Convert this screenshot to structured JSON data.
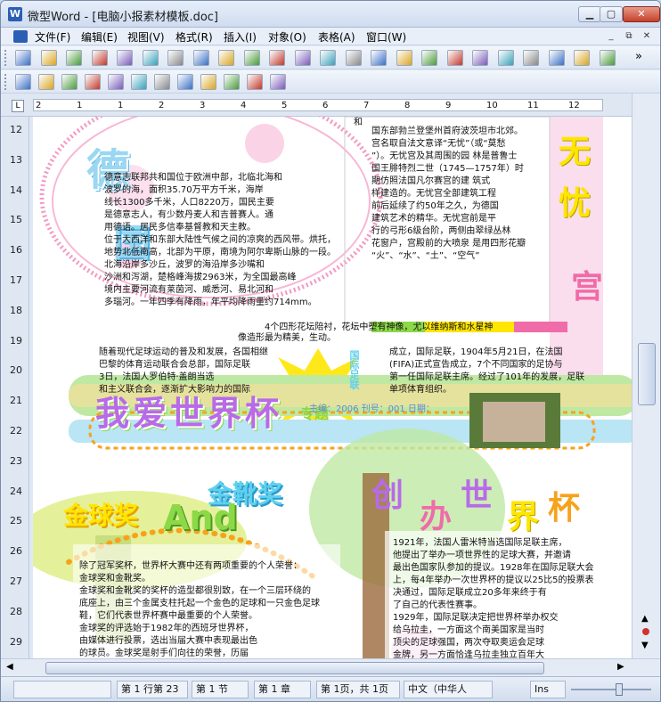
{
  "window": {
    "title": "微型Word - [电脑小报素材模板.doc]",
    "app_icon": "W",
    "controls": {
      "minimize": "▁",
      "maximize": "▢",
      "close": "✕"
    }
  },
  "menu": {
    "items": [
      "文件(F)",
      "编辑(E)",
      "视图(V)",
      "格式(R)",
      "插入(I)",
      "对象(O)",
      "表格(A)",
      "窗口(W)"
    ],
    "mdi": [
      "_",
      "⧉",
      "✕"
    ]
  },
  "toolbar1": {
    "icons": [
      "new-document-icon",
      "open-folder-icon",
      "save-icon",
      "print-icon",
      "print-preview-icon",
      "cut-icon",
      "copy-icon",
      "paste-icon",
      "undo-icon",
      "redo-icon",
      "find-icon",
      "page-number-icon",
      "header-icon",
      "page-setup-icon",
      "columns-icon",
      "zoom-icon",
      "percent-icon",
      "font-icon",
      "format-painter-icon",
      "spellcheck-icon",
      "chart-icon",
      "table-icon",
      "text-box-icon",
      "drawing-icon"
    ],
    "more": "»"
  },
  "toolbar2": {
    "icons": [
      "draw-shape-icon",
      "edit-shape-icon",
      "erase-icon",
      "select-icon",
      "copy-shape-icon",
      "group-icon",
      "star-icon",
      "pen-icon",
      "pencil-icon",
      "brush-icon",
      "note-icon",
      "wizard-icon"
    ]
  },
  "ruler": {
    "tab_marker": "L",
    "ticks": [
      "2",
      "1",
      "1",
      "2",
      "3",
      "4",
      "5",
      "6",
      "7",
      "8",
      "9",
      "10",
      "11",
      "12"
    ],
    "vertical": [
      "12",
      "13",
      "14",
      "15",
      "16",
      "17",
      "18",
      "19",
      "20",
      "21",
      "22",
      "23",
      "24",
      "25",
      "26",
      "27",
      "28",
      "29"
    ]
  },
  "page": {
    "headline_de": "德",
    "headline_guo": "国",
    "headline_wu": "无",
    "headline_you": "忧",
    "headline_gong": "宫",
    "germany_lines": [
      "德意志联邦共和国位于欧洲中部，北临北海和",
      "波罗的海，面积35.70万平方千米，海岸",
      "线长1300多千米，人口8220万，国民主要",
      "是德意志人，有少数丹麦人和吉普赛人。通",
      "用德语。居民多信奉基督教和天主教。",
      "位于大西洋和东部大陆性气候之间的凉爽的西风带。烘托，",
      "地势北低南高，北部为平原，南境为阿尔卑斯山脉的一段。",
      "北海沿岸多沙丘，波罗的海沿岸多沙嘴和",
      "沙洲和泻湖，楚格峰海拔2963米，为全国最高峰",
      "境内主要河流有莱茵河、威悉河、易北河和",
      "多瑙河。一年四季有降雨，年平均降雨量约714mm。"
    ],
    "palace_lines": [
      "国东部勃兰登堡州首府波茨坦市北郊。",
      "宫名取自法文意译“无忧”（或“莫愁",
      "”）。无忧宫及其周围的园 林是普鲁士",
      "国王腓特烈二世（1745—1757年）时",
      "期仿照法国凡尔赛宫的建 筑式",
      "样建造的。无忧宫全部建筑工程",
      "前后延续了约50年之久，为德国",
      "建筑艺术的精华。无忧宫前是平",
      "行的弓形6级台阶，两侧由翠绿丛林",
      "花窗户，宫殿前的大喷泉 是用四形花瓣",
      "“火”、“水”、“土”、“空气”"
    ],
    "palace_top": "和",
    "col_left": [
      "随着现代足球运动的普及和发展，各国相继",
      "巴黎的体育运动联合会总部，国际足联",
      "3日，法国人罗伯特·盖朗当选",
      "和主义联合会，逐渐扩大影响力的国际"
    ],
    "col_right": [
      "成立，国际足联，1904年5月21日，在法国",
      "(FIFA)正式宣告成立，7个不同国家的足协与",
      "第一任国际足联主席。经过了101年的发展，足联",
      "单项体育组织。"
    ],
    "mid_caption": "4个四形花坛陪衬，花坛中塑有神像，尤以维纳斯和水星神",
    "mid_caption2": "像造形最为精美，生动。",
    "worldcup_banner": "我爱世界杯",
    "banner_suffix": "专题",
    "issue_info": "主编：2006  刊号：001  日期：",
    "mid_strip": "国际足联",
    "golden_ball": "金球奖",
    "golden_boot": "金靴奖",
    "and_text": "And",
    "chuang": "创",
    "ban": "办",
    "shi": "世",
    "jie": "界",
    "bei": "杯",
    "awards_lines": [
      "除了冠军奖杯，世界杯大赛中还有两项重要的个人荣誉：",
      "金球奖和金靴奖。",
      "金球奖和金靴奖的奖杯的造型都很别致，在一个三层环绕的",
      "底座上，由三个金属支柱托起一个金色的足球和一只金色足球",
      "鞋，它们代表世界杯赛中最重要的个人荣誉。",
      "金球奖的评选始于1982年的西班牙世界杯，",
      "由媒体进行投票，选出当届大赛中表现最出色",
      "的球员。金球奖是射手们向往的荣誉，历届",
      "世界杯进球最多的人，将荣获金靴奖。"
    ],
    "history_lines": [
      "1921年，法国人雷米特当选国际足联主席，",
      "他提出了举办一项世界性的足球大赛，并邀请",
      "最出色国家队参加的提议。1928年在国际足联大会",
      "上，每4年举办一次世界杯的提议以25比5的投票表",
      "决通过，国际足联成立20多年来终于有",
      "了自己的代表性赛事。",
      "1929年，国际足联决定把世界杯举办权交",
      "给乌拉圭，一方面这个南美国家是当时",
      "顶尖的足球强国，两次夺取奥运会足球",
      "金牌，另一方面恰逢乌拉圭独立百年大",
      "庆。"
    ]
  },
  "status": {
    "position": "第 1 行第 23",
    "section": "第 1 节",
    "chapter": "第 1 章",
    "pages": "第 1页，共 1页",
    "lang": "中文（中华人",
    "mode": "Ins"
  },
  "colors": {
    "pink": "#f06ca8",
    "yellow": "#ffe600",
    "green": "#8cd848",
    "purple": "#b86ae8",
    "cyan": "#5ed0f0",
    "orange": "#f7a21b"
  }
}
